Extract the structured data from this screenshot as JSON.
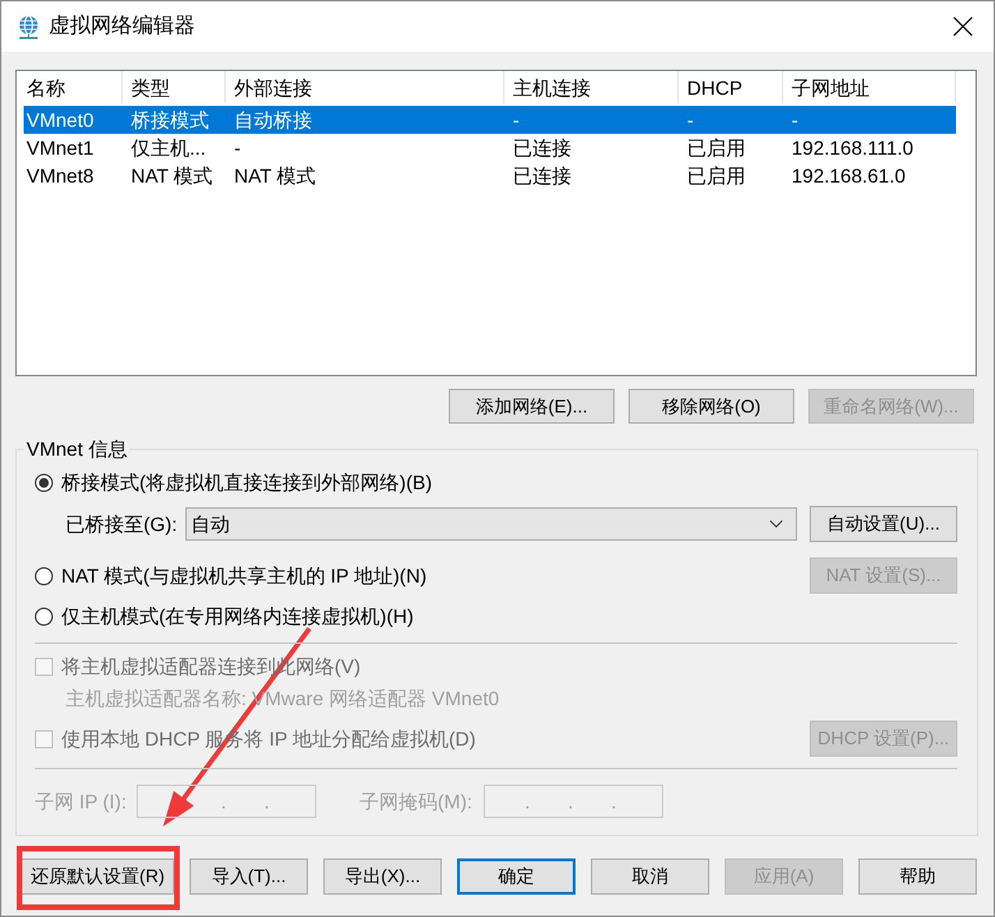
{
  "window": {
    "title": "虚拟网络编辑器"
  },
  "network_list": {
    "columns": [
      "名称",
      "类型",
      "外部连接",
      "主机连接",
      "DHCP",
      "子网地址"
    ],
    "rows": [
      {
        "cells": [
          "VMnet0",
          "桥接模式",
          "自动桥接",
          "-",
          "-",
          "-"
        ],
        "selected": true
      },
      {
        "cells": [
          "VMnet1",
          "仅主机...",
          "-",
          "已连接",
          "已启用",
          "192.168.111.0"
        ],
        "selected": false
      },
      {
        "cells": [
          "VMnet8",
          "NAT 模式",
          "NAT 模式",
          "已连接",
          "已启用",
          "192.168.61.0"
        ],
        "selected": false
      }
    ]
  },
  "list_buttons": [
    {
      "label": "添加网络(E)...",
      "disabled": false
    },
    {
      "label": "移除网络(O)",
      "disabled": false
    },
    {
      "label": "重命名网络(W)...",
      "disabled": true
    }
  ],
  "vmnet_info": {
    "title": "VMnet 信息",
    "modes": [
      {
        "label": "桥接模式(将虚拟机直接连接到外部网络)(B)",
        "selected": true,
        "bridged_to": {
          "label": "已桥接至(G):",
          "value": "自动",
          "button": {
            "label": "自动设置(U)...",
            "disabled": false
          }
        }
      },
      {
        "label": "NAT 模式(与虚拟机共享主机的 IP 地址)(N)",
        "selected": false,
        "button": {
          "label": "NAT 设置(S)...",
          "disabled": true
        }
      },
      {
        "label": "仅主机模式(在专用网络内连接虚拟机)(H)",
        "selected": false
      }
    ],
    "host_adapter": {
      "label": "将主机虚拟适配器连接到此网络(V)",
      "checked": false,
      "disabled": true,
      "adapter_name": "主机虚拟适配器名称: VMware 网络适配器 VMnet0"
    },
    "dhcp": {
      "label": "使用本地 DHCP 服务将 IP 地址分配给虚拟机(D)",
      "checked": false,
      "disabled": true,
      "button": {
        "label": "DHCP 设置(P)...",
        "disabled": true
      }
    },
    "subnet_ip": {
      "label": "子网 IP (I):",
      "separators": [
        ".",
        "."
      ],
      "disabled": true
    },
    "subnet_mask": {
      "label": "子网掩码(M):",
      "separators": [
        ".",
        ".",
        "."
      ],
      "disabled": true
    }
  },
  "dialog_buttons": [
    {
      "label": "还原默认设置(R)",
      "disabled": false,
      "default": false,
      "highlighted": true
    },
    {
      "label": "导入(T)...",
      "disabled": false,
      "default": false,
      "highlighted": false
    },
    {
      "label": "导出(X)...",
      "disabled": false,
      "default": false,
      "highlighted": false
    },
    {
      "label": "确定",
      "disabled": false,
      "default": true,
      "highlighted": false
    },
    {
      "label": "取消",
      "disabled": false,
      "default": false,
      "highlighted": false
    },
    {
      "label": "应用(A)",
      "disabled": true,
      "default": false,
      "highlighted": false
    },
    {
      "label": "帮助",
      "disabled": false,
      "default": false,
      "highlighted": false
    }
  ]
}
